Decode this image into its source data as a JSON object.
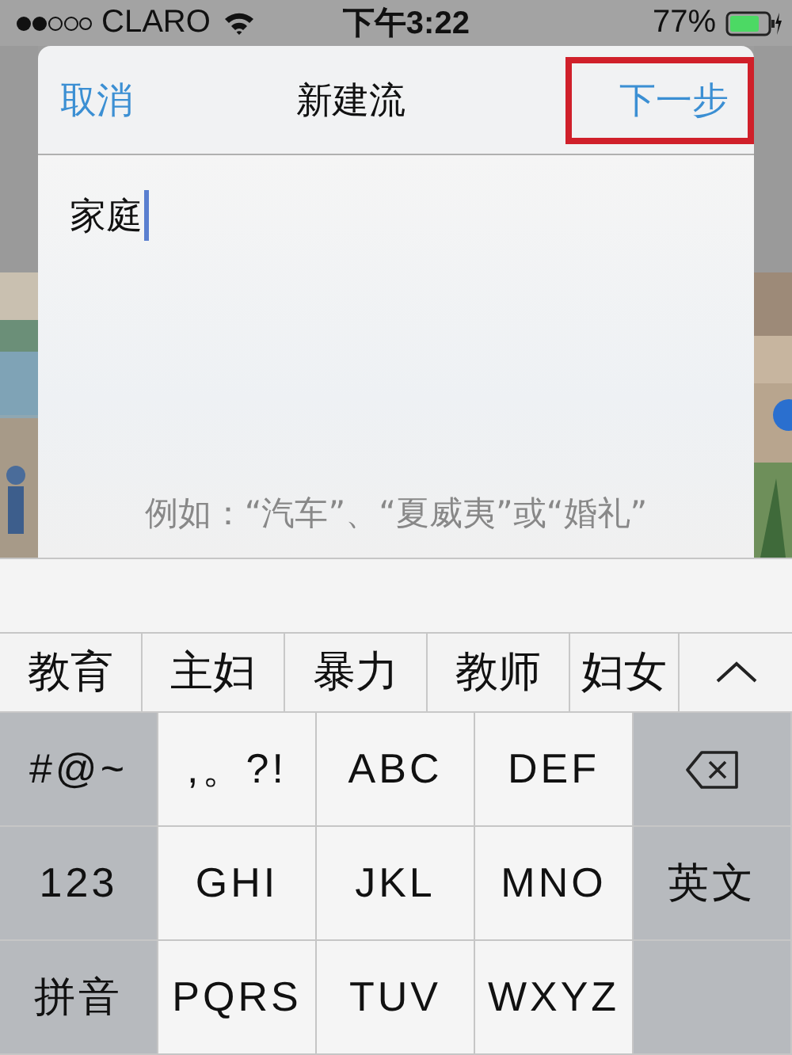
{
  "status_bar": {
    "carrier": "CLARO",
    "time": "下午3:22",
    "battery": "77%"
  },
  "dialog": {
    "cancel": "取消",
    "title": "新建流",
    "next": "下一步",
    "next_highlighted": true,
    "field_value": "家庭",
    "hint": "例如：“汽车”、“夏威夷”或“婚礼”"
  },
  "candidates": [
    "教育",
    "主妇",
    "暴力",
    "教师",
    "妇女"
  ],
  "keys": [
    {
      "label": "#@~",
      "kind": "func"
    },
    {
      "label": ",。?!",
      "kind": "char"
    },
    {
      "label": "ABC",
      "kind": "char"
    },
    {
      "label": "DEF",
      "kind": "char"
    },
    {
      "kind": "delete"
    },
    {
      "label": "123",
      "kind": "func"
    },
    {
      "label": "GHI",
      "kind": "char"
    },
    {
      "label": "JKL",
      "kind": "char"
    },
    {
      "label": "MNO",
      "kind": "char"
    },
    {
      "label": "英文",
      "kind": "func"
    },
    {
      "label": "拼音",
      "kind": "func"
    },
    {
      "label": "PQRS",
      "kind": "char"
    },
    {
      "label": "TUV",
      "kind": "char"
    },
    {
      "label": "WXYZ",
      "kind": "char"
    },
    {
      "kind": "func"
    }
  ]
}
